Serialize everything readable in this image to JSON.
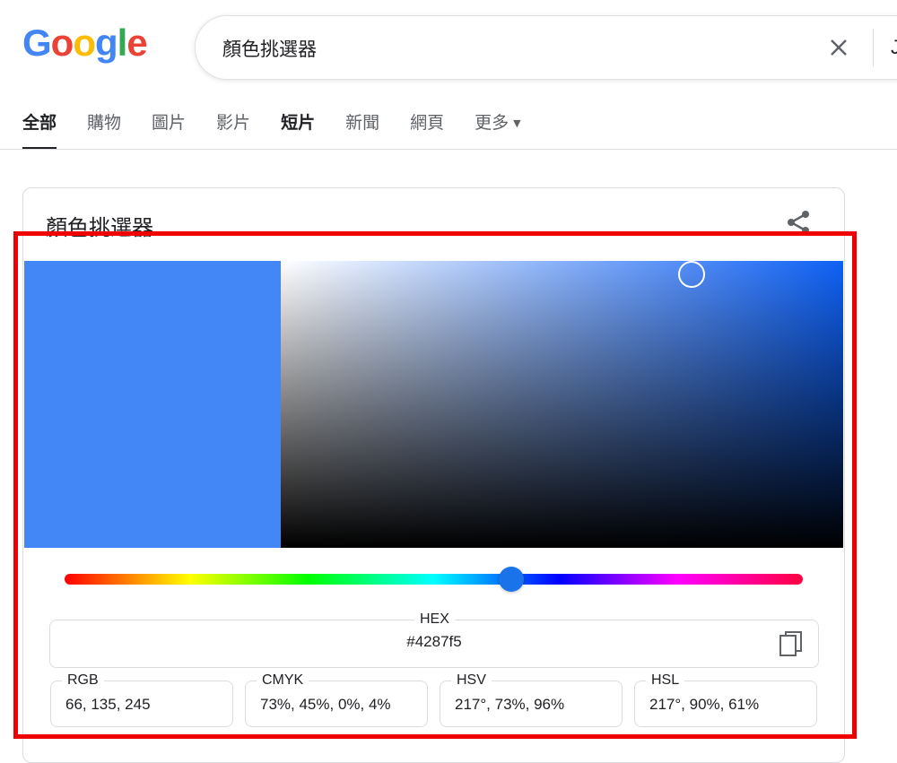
{
  "logo": {
    "letters": [
      "G",
      "o",
      "o",
      "g",
      "l",
      "e"
    ],
    "colors": [
      "#4285f4",
      "#ea4335",
      "#fbbc05",
      "#4285f4",
      "#34a853",
      "#ea4335"
    ]
  },
  "search": {
    "query": "顏色挑選器",
    "voice_partial": "J"
  },
  "tabs": [
    {
      "label": "全部",
      "active": true
    },
    {
      "label": "購物"
    },
    {
      "label": "圖片"
    },
    {
      "label": "影片"
    },
    {
      "label": "短片"
    },
    {
      "label": "新聞"
    },
    {
      "label": "網頁"
    },
    {
      "label": "更多"
    }
  ],
  "card": {
    "title": "顏色挑選器"
  },
  "picker": {
    "selected_color": "#4287f5",
    "hue_gradient_base": "#0f61f5",
    "hue_position_fraction": 0.6,
    "hex": {
      "label": "HEX",
      "value": "#4287f5"
    },
    "rgb": {
      "label": "RGB",
      "value": "66, 135, 245"
    },
    "cmyk": {
      "label": "CMYK",
      "value": "73%, 45%, 0%, 4%"
    },
    "hsv": {
      "label": "HSV",
      "value": "217°, 73%, 96%"
    },
    "hsl": {
      "label": "HSL",
      "value": "217°, 90%, 61%"
    }
  },
  "colors": {
    "annotation": "#ee0000",
    "accent": "#1a73e8"
  }
}
